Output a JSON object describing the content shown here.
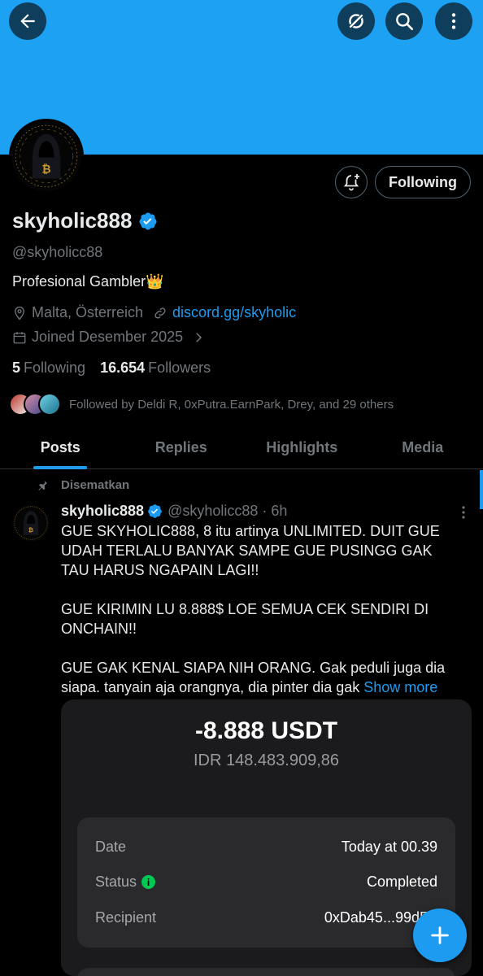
{
  "profile": {
    "display_name": "skyholic888",
    "handle": "@skyholicc88",
    "bio": "Profesional Gambler👑",
    "location": "Malta, Österreich",
    "link": "discord.gg/skyholic",
    "joined": "Joined Desember 2025",
    "following_count": "5",
    "following_label": "Following",
    "followers_count": "16.654",
    "followers_label": "Followers",
    "followed_by": "Followed by Deldi R, 0xPutra.EarnPark, Drey, and 29 others",
    "following_button": "Following"
  },
  "icons": {
    "back": "arrow-left-icon",
    "grok": "grok-icon",
    "search": "search-icon",
    "more": "more-vertical-icon",
    "notify": "bell-plus-icon",
    "verified": "verified-badge-icon",
    "location": "location-pin-icon",
    "link": "link-icon",
    "calendar": "calendar-icon",
    "pin": "pin-icon",
    "compose": "plus-icon"
  },
  "tabs": [
    {
      "label": "Posts",
      "active": true
    },
    {
      "label": "Replies",
      "active": false
    },
    {
      "label": "Highlights",
      "active": false
    },
    {
      "label": "Media",
      "active": false
    }
  ],
  "post": {
    "pinned_label": "Disematkan",
    "name": "skyholic888",
    "handle_time": "@skyholicc88 · 6h",
    "body": "GUE SKYHOLIC888, 8 itu artinya UNLIMITED. DUIT GUE UDAH TERLALU BANYAK SAMPE GUE PUSINGG GAK TAU HARUS NGAPAIN LAGI!!\n\nGUE KIRIMIN LU 8.888$ LOE SEMUA CEK SENDIRI DI ONCHAIN!!\n\nGUE GAK KENAL SIAPA NIH ORANG. Gak peduli juga dia siapa. tanyain aja orangnya, dia pinter dia gak ",
    "show_more": "Show more"
  },
  "transaction": {
    "amount": "-8.888 USDT",
    "fiat": "IDR 148.483.909,86",
    "date_label": "Date",
    "date_value": "Today at 00.39",
    "status_label": "Status",
    "status_value": "Completed",
    "recipient_label": "Recipient",
    "recipient_value": "0xDab45...99dE9"
  },
  "colors": {
    "banner": "#1da1f2",
    "accent": "#1d9bf0",
    "background": "#000000",
    "muted": "#71767b"
  }
}
